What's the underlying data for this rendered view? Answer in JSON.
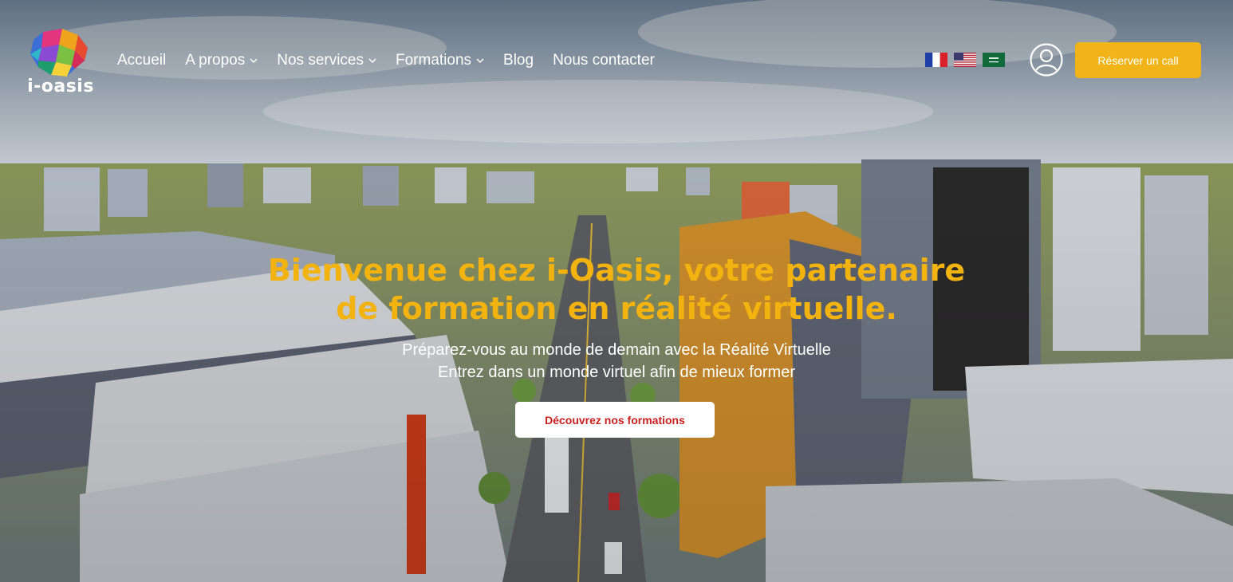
{
  "brand": {
    "logo_text": "i-oasis"
  },
  "nav": {
    "items": [
      {
        "label": "Accueil",
        "dropdown": false
      },
      {
        "label": "A propos",
        "dropdown": true
      },
      {
        "label": "Nos services",
        "dropdown": true
      },
      {
        "label": "Formations",
        "dropdown": true
      },
      {
        "label": "Blog",
        "dropdown": false
      },
      {
        "label": "Nous contacter",
        "dropdown": false
      }
    ]
  },
  "languages": [
    "fr-flag-icon",
    "us-flag-icon",
    "sa-flag-icon"
  ],
  "header": {
    "book_call_label": "Réserver un call"
  },
  "hero": {
    "title_line1": "Bienvenue chez i-Oasis, votre partenaire",
    "title_line2": "de formation en réalité virtuelle.",
    "subtitle_line1": "Préparez-vous au monde de demain avec la Réalité Virtuelle",
    "subtitle_line2": "Entrez dans un monde virtuel afin de mieux former",
    "cta_label": "Découvrez nos formations"
  },
  "colors": {
    "accent": "#f0b418",
    "title": "#f2b20f",
    "cta_text": "#c8201f"
  }
}
